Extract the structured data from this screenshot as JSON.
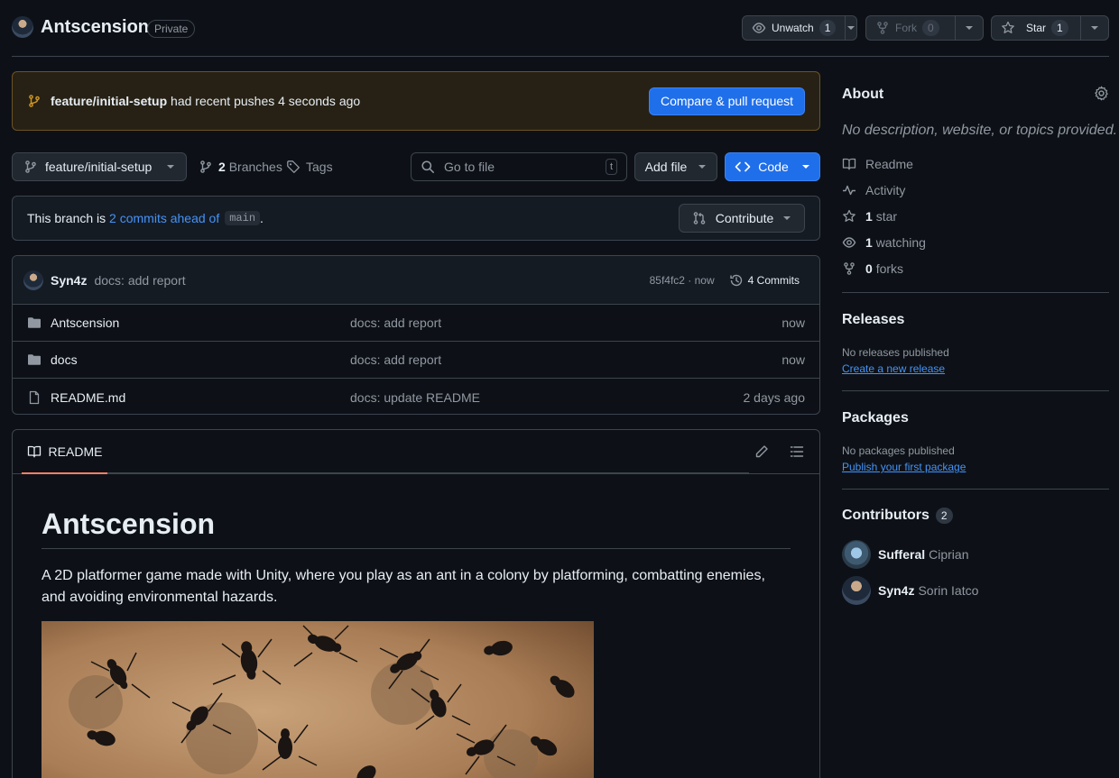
{
  "repo": {
    "name": "Antscension",
    "visibility": "Private",
    "unwatch_label": "Unwatch",
    "unwatch_count": "1",
    "fork_label": "Fork",
    "fork_count": "0",
    "star_label": "Star",
    "star_count": "1"
  },
  "banner": {
    "branch": "feature/initial-setup",
    "message": "had recent pushes 4 seconds ago",
    "button": "Compare & pull request"
  },
  "toolbar": {
    "branch": "feature/initial-setup",
    "branches_count": "2",
    "branches_label": "Branches",
    "tags_label": "Tags",
    "goto_placeholder": "Go to file",
    "goto_shortcut": "t",
    "add_file": "Add file",
    "code": "Code"
  },
  "ahead": {
    "prefix": "This branch is",
    "link": "2 commits ahead of",
    "base": "main",
    "suffix": ".",
    "contribute": "Contribute"
  },
  "latest_commit": {
    "author": "Syn4z",
    "message": "docs: add report",
    "sha_time": "85f4fc2 · now",
    "commits": "4 Commits"
  },
  "files": [
    {
      "type": "folder",
      "name": "Antscension",
      "message": "docs: add report",
      "time": "now"
    },
    {
      "type": "folder",
      "name": "docs",
      "message": "docs: add report",
      "time": "now"
    },
    {
      "type": "file",
      "name": "README.md",
      "message": "docs: update README",
      "time": "2 days ago"
    }
  ],
  "readme": {
    "tab": "README",
    "title": "Antscension",
    "description": "A 2D platformer game made with Unity, where you play as an ant in a colony by platforming, combatting enemies, and avoiding environmental hazards."
  },
  "sidebar": {
    "about_title": "About",
    "about_desc": "No description, website, or topics provided.",
    "items": [
      {
        "icon": "book-icon",
        "count": "",
        "label": "Readme"
      },
      {
        "icon": "pulse-icon",
        "count": "",
        "label": "Activity"
      },
      {
        "icon": "star-icon",
        "count": "1",
        "label": "star"
      },
      {
        "icon": "eye-icon",
        "count": "1",
        "label": "watching"
      },
      {
        "icon": "fork-icon",
        "count": "0",
        "label": "forks"
      }
    ],
    "releases_title": "Releases",
    "releases_note": "No releases published",
    "releases_link": "Create a new release",
    "packages_title": "Packages",
    "packages_note": "No packages published",
    "packages_link": "Publish your first package",
    "contributors_title": "Contributors",
    "contributors_count": "2",
    "contributors": [
      {
        "login": "Sufferal",
        "name": "Ciprian"
      },
      {
        "login": "Syn4z",
        "name": "Sorin Iatco"
      }
    ]
  },
  "colors": {
    "accent": "#1f6feb",
    "link": "#4493f8",
    "banner_bg": "#272115",
    "tab_underline": "#f78166"
  }
}
